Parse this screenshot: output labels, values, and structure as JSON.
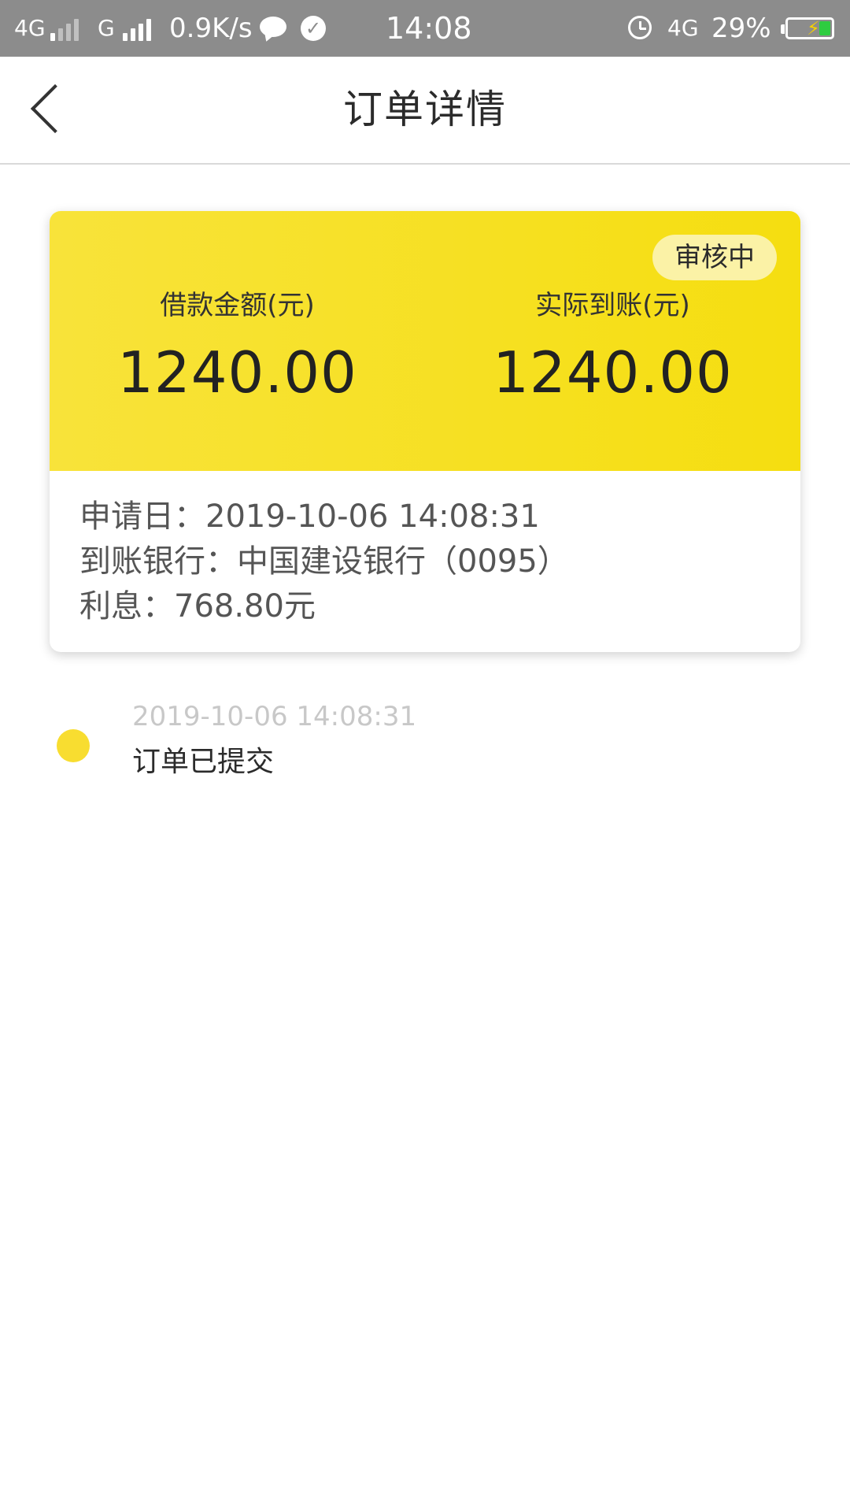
{
  "status_bar": {
    "network1": "4G",
    "network2": "G",
    "speed": "0.9K/s",
    "time": "14:08",
    "network3": "4G",
    "battery": "29%"
  },
  "nav": {
    "title": "订单详情"
  },
  "card": {
    "status": "审核中",
    "loan_label": "借款金额(元)",
    "loan_amount": "1240.00",
    "received_label": "实际到账(元)",
    "received_amount": "1240.00",
    "apply_date": "申请日：2019-10-06 14:08:31",
    "bank": "到账银行：中国建设银行（0095）",
    "interest": "利息：768.80元"
  },
  "timeline": [
    {
      "time": "2019-10-06 14:08:31",
      "text": "订单已提交"
    }
  ],
  "colors": {
    "accent_yellow": "#f8e33a",
    "badge_bg": "#fbf2a6",
    "status_bar_bg": "#8c8c8c"
  }
}
